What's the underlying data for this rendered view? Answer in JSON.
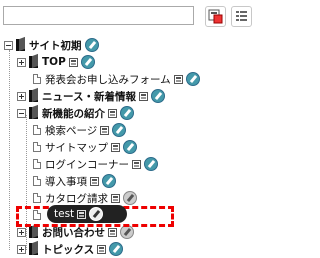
{
  "toolbar": {
    "search_placeholder": "",
    "icon_1": "layout-toggle-icon",
    "icon_2": "list-view-icon"
  },
  "tree": {
    "root": {
      "label": "サイト初期"
    },
    "items": [
      {
        "label": "TOP"
      },
      {
        "label": "発表会お申し込みフォーム"
      },
      {
        "label": "ニュース・新着情報"
      },
      {
        "label": "新機能の紹介"
      },
      {
        "label": "検索ページ"
      },
      {
        "label": "サイトマップ"
      },
      {
        "label": "ログインコーナー"
      },
      {
        "label": "導入事項"
      },
      {
        "label": "カタログ請求"
      },
      {
        "label": "お問い合わせ"
      },
      {
        "label": "トピックス"
      }
    ]
  },
  "drag": {
    "label": "test"
  },
  "colors": {
    "drop_indicator": "#e00000",
    "drag_pill": "#222222",
    "edit_icon": "#4499aa"
  }
}
